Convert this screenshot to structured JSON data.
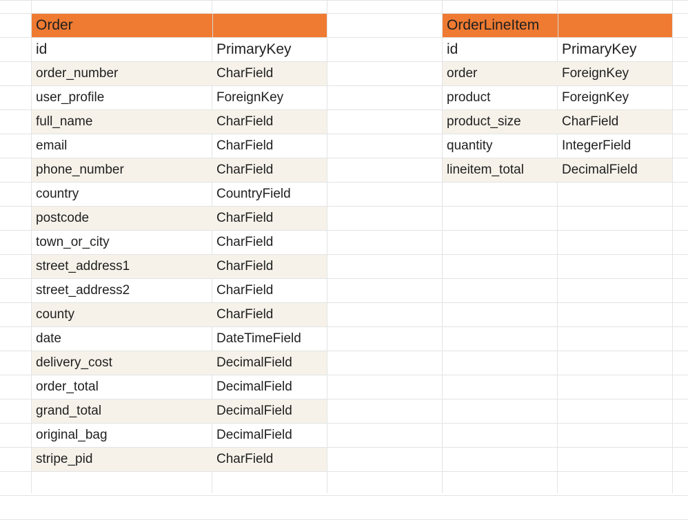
{
  "tables": [
    {
      "title": "Order",
      "rows": [
        {
          "field": "id",
          "type": "PrimaryKey"
        },
        {
          "field": "order_number",
          "type": "CharField"
        },
        {
          "field": "user_profile",
          "type": "ForeignKey"
        },
        {
          "field": "full_name",
          "type": "CharField"
        },
        {
          "field": "email",
          "type": "CharField"
        },
        {
          "field": "phone_number",
          "type": "CharField"
        },
        {
          "field": "country",
          "type": "CountryField"
        },
        {
          "field": "postcode",
          "type": "CharField"
        },
        {
          "field": "town_or_city",
          "type": "CharField"
        },
        {
          "field": "street_address1",
          "type": "CharField"
        },
        {
          "field": "street_address2",
          "type": "CharField"
        },
        {
          "field": "county",
          "type": "CharField"
        },
        {
          "field": "date",
          "type": "DateTimeField"
        },
        {
          "field": "delivery_cost",
          "type": "DecimalField"
        },
        {
          "field": "order_total",
          "type": "DecimalField"
        },
        {
          "field": "grand_total",
          "type": "DecimalField"
        },
        {
          "field": "original_bag",
          "type": "DecimalField"
        },
        {
          "field": "stripe_pid",
          "type": "CharField"
        }
      ]
    },
    {
      "title": "OrderLineItem",
      "rows": [
        {
          "field": "id",
          "type": "PrimaryKey"
        },
        {
          "field": "order",
          "type": "ForeignKey"
        },
        {
          "field": "product",
          "type": "ForeignKey"
        },
        {
          "field": "product_size",
          "type": "CharField"
        },
        {
          "field": "quantity",
          "type": "IntegerField"
        },
        {
          "field": "lineitem_total",
          "type": "DecimalField"
        }
      ]
    }
  ],
  "colors": {
    "header_bg": "#ef7a31",
    "alt_row_bg": "#f6f2ea",
    "gridline": "#e2e3e3"
  }
}
